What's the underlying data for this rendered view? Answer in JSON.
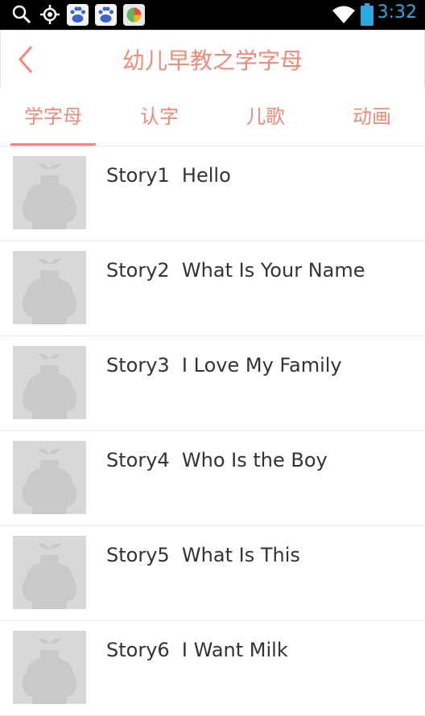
{
  "status_bar": {
    "time": "3:32",
    "icons": [
      "search-icon",
      "location-icon",
      "baidu-icon",
      "baidu-icon",
      "app-icon",
      "wifi-icon",
      "battery-icon"
    ]
  },
  "header": {
    "title": "幼儿早教之学字母",
    "back_icon": "chevron-left-icon"
  },
  "tabs": [
    {
      "label": "学字母",
      "active": true
    },
    {
      "label": "认字",
      "active": false
    },
    {
      "label": "儿歌",
      "active": false
    },
    {
      "label": "动画",
      "active": false
    }
  ],
  "stories": [
    {
      "title": "Story1  Hello"
    },
    {
      "title": "Story2  What Is Your Name"
    },
    {
      "title": "Story3  I Love My Family"
    },
    {
      "title": "Story4  Who Is the Boy"
    },
    {
      "title": "Story5  What Is This"
    },
    {
      "title": "Story6  I Want Milk"
    }
  ],
  "colors": {
    "accent": "#f08a7b",
    "status_time": "#2aa9e0",
    "thumbnail": "#d8d8d8"
  }
}
